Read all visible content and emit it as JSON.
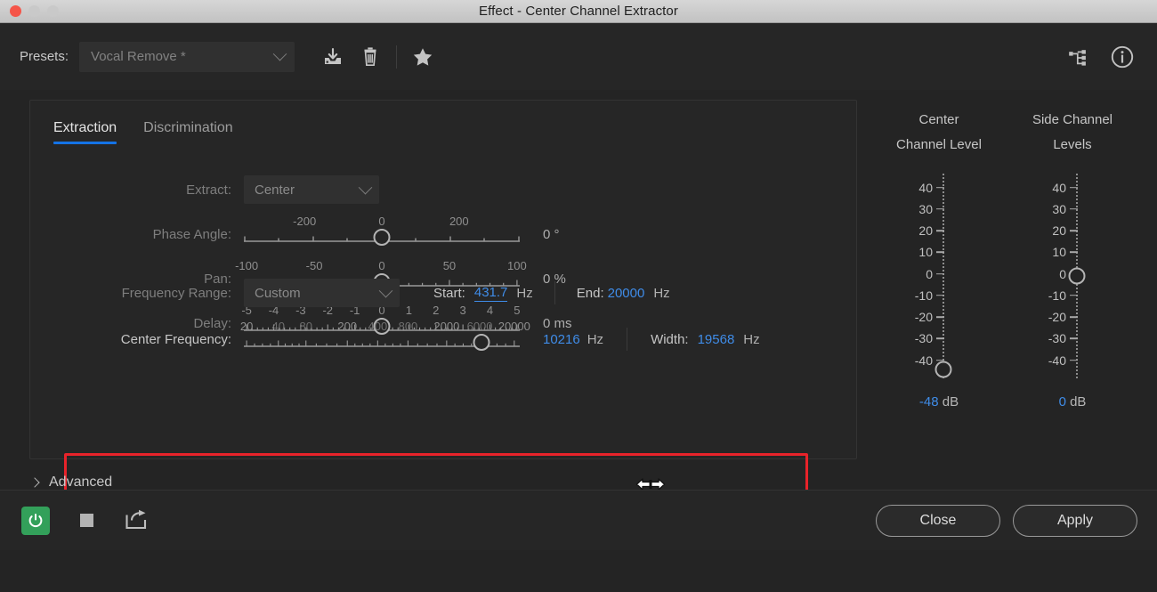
{
  "window": {
    "title": "Effect - Center Channel Extractor",
    "traffic_lights": [
      "close",
      "minimize",
      "zoom"
    ]
  },
  "presets": {
    "label": "Presets:",
    "value": "Vocal Remove *",
    "icons": [
      "save-preset-icon",
      "delete-preset-icon",
      "favorite-star-icon"
    ],
    "right_icons": [
      "routing-icon",
      "info-icon"
    ]
  },
  "tabs": [
    {
      "label": "Extraction",
      "active": true
    },
    {
      "label": "Discrimination",
      "active": false
    }
  ],
  "extract": {
    "label": "Extract:",
    "value": "Center"
  },
  "sliders": [
    {
      "label": "Phase Angle:",
      "scale_labels": [
        "-200",
        "0",
        "200"
      ],
      "scale_positions": [
        22,
        50,
        78
      ],
      "min": -360,
      "max": 360,
      "value": 0,
      "knob_percent": 50,
      "readout": "0 °"
    },
    {
      "label": "Pan:",
      "scale_labels": [
        "-100",
        "-50",
        "0",
        "50",
        "100"
      ],
      "scale_positions": [
        1,
        25.5,
        50,
        74.5,
        99
      ],
      "min": -100,
      "max": 100,
      "value": 0,
      "knob_percent": 50,
      "readout": "0 %"
    },
    {
      "label": "Delay:",
      "scale_labels": [
        "-5",
        "-4",
        "-3",
        "-2",
        "-1",
        "0",
        "1",
        "2",
        "3",
        "4",
        "5"
      ],
      "scale_positions": [
        1,
        10.8,
        20.6,
        30.4,
        40.2,
        50,
        59.8,
        69.6,
        79.4,
        89.2,
        99
      ],
      "min": -5,
      "max": 5,
      "value": 0,
      "knob_percent": 50,
      "readout": "0 ms"
    }
  ],
  "frequency": {
    "range_label": "Frequency Range:",
    "range_value": "Custom",
    "start_label": "Start:",
    "start_value": "431.7",
    "start_unit": "Hz",
    "end_label": "End:",
    "end_value": "20000",
    "end_unit": "Hz",
    "center_label": "Center Frequency:",
    "center_value": "10216",
    "center_unit": "Hz",
    "width_label": "Width:",
    "width_value": "19568",
    "width_unit": "Hz",
    "center_scale_labels": [
      "20",
      "40",
      "80",
      "200",
      "400",
      "800",
      "2000",
      "6000",
      "20000"
    ],
    "center_scale_positions": [
      1,
      12.5,
      22.5,
      37.5,
      48.5,
      59.5,
      73.5,
      85.5,
      98
    ],
    "center_knob_percent": 86,
    "highlight_color": "#e8232a",
    "cursor": "horizontal-resize-cursor"
  },
  "advanced": {
    "label": "Advanced",
    "expanded": false
  },
  "meters": [
    {
      "title_line1": "Center",
      "title_line2": "Channel Level",
      "ticks": [
        40,
        30,
        20,
        10,
        0,
        -10,
        -20,
        -30,
        -40
      ],
      "min": -48,
      "max": 48,
      "value": "-48",
      "unit": "dB",
      "knob_percent": 96
    },
    {
      "title_line1": "Side Channel",
      "title_line2": "Levels",
      "ticks": [
        40,
        30,
        20,
        10,
        0,
        -10,
        -20,
        -30,
        -40
      ],
      "min": -48,
      "max": 48,
      "value": "0",
      "unit": "dB",
      "knob_percent": 50
    }
  ],
  "footer": {
    "transport": [
      "power-toggle-icon",
      "stop-icon",
      "export-icon"
    ],
    "close_label": "Close",
    "apply_label": "Apply"
  }
}
